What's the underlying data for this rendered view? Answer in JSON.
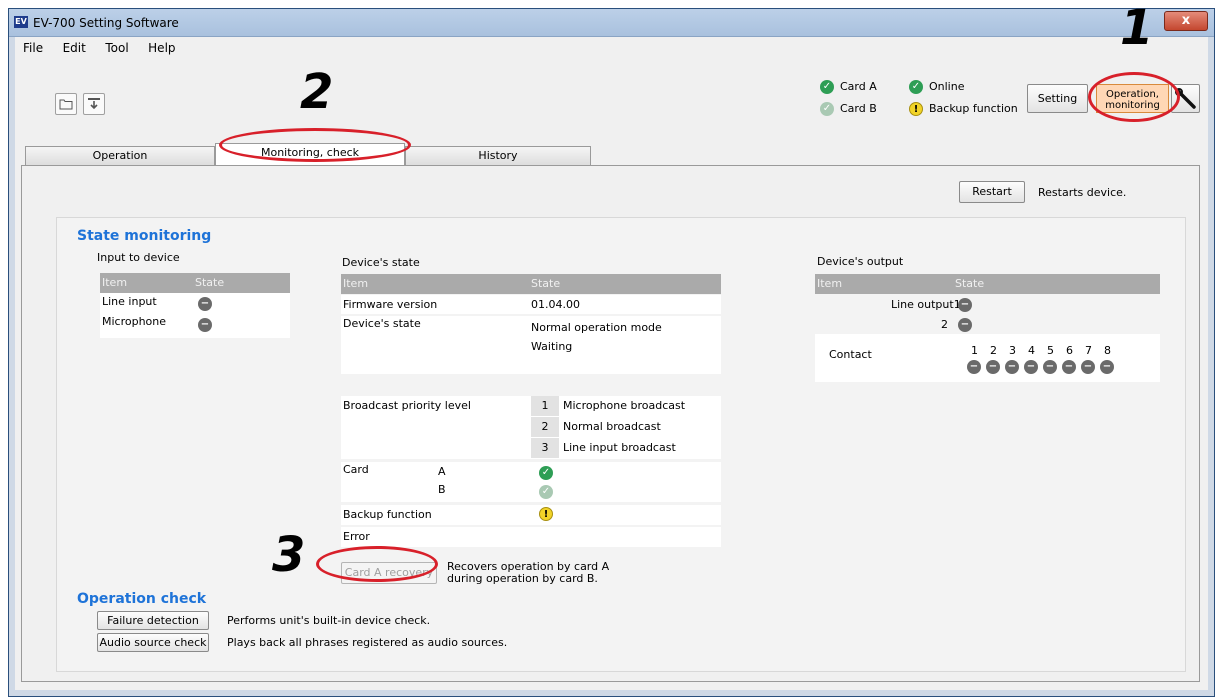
{
  "window": {
    "title": "EV-700 Setting Software",
    "icon": "EV",
    "close_glyph": "x"
  },
  "menu": [
    "File",
    "Edit",
    "Tool",
    "Help"
  ],
  "toolbar": {
    "open_icon": "folder-icon",
    "save_icon": "download-icon"
  },
  "status": {
    "card_a": "Card A",
    "card_b": "Card B",
    "online": "Online",
    "backup": "Backup function"
  },
  "mode_buttons": {
    "setting": "Setting",
    "operation": "Operation, monitoring"
  },
  "tabs": [
    "Operation",
    "Monitoring, check",
    "History"
  ],
  "restart": {
    "button": "Restart",
    "description": "Restarts device."
  },
  "state_monitoring": {
    "title": "State monitoring",
    "input": {
      "heading": "Input to device",
      "col_item": "Item",
      "col_state": "State",
      "rows": [
        "Line input",
        "Microphone"
      ]
    },
    "device_state": {
      "heading": "Device's state",
      "col_item": "Item",
      "col_state": "State",
      "firmware_label": "Firmware version",
      "firmware_value": "01.04.00",
      "state_label": "Device's state",
      "state_value1": "Normal operation mode",
      "state_value2": "Waiting",
      "priority_label": "Broadcast priority level",
      "priorities": [
        {
          "num": "1",
          "label": "Microphone broadcast"
        },
        {
          "num": "2",
          "label": "Normal broadcast"
        },
        {
          "num": "3",
          "label": "Line input broadcast"
        }
      ],
      "card_label": "Card",
      "card_a": "A",
      "card_b": "B",
      "backup_label": "Backup function",
      "error_label": "Error"
    },
    "output": {
      "heading": "Device's output",
      "col_item": "Item",
      "col_state": "State",
      "line_output": "Line output1",
      "line_output2": "2",
      "contact_label": "Contact",
      "contacts": [
        "1",
        "2",
        "3",
        "4",
        "5",
        "6",
        "7",
        "8"
      ]
    },
    "recovery": {
      "button": "Card A recovery",
      "description1": "Recovers operation by card A",
      "description2": "during operation by card B."
    }
  },
  "operation_check": {
    "title": "Operation check",
    "failure_button": "Failure detection",
    "failure_desc": "Performs unit's built-in device check.",
    "audio_button": "Audio source check",
    "audio_desc": "Plays back all phrases registered as audio sources."
  },
  "annotations": [
    "1",
    "2",
    "3"
  ],
  "colors": {
    "accent_blue": "#1e73d8",
    "annotation_red": "#d8202a",
    "operation_bg": "#ffd7b5"
  }
}
